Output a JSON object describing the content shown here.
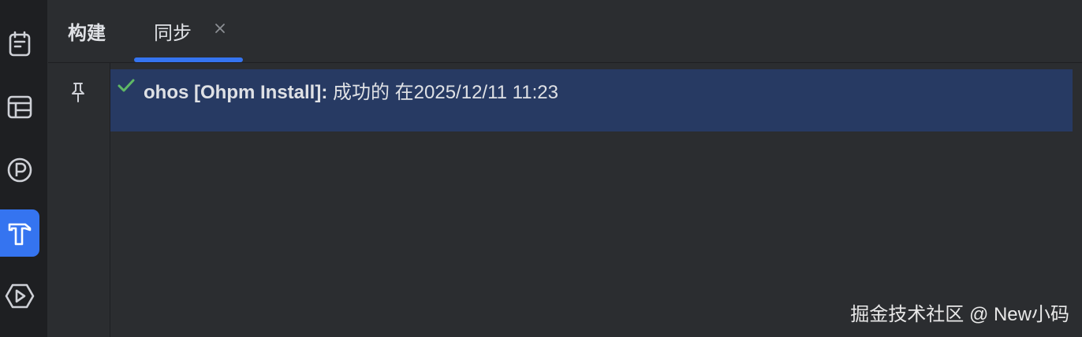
{
  "toolstrip": {
    "items": [
      {
        "icon": "notes-icon",
        "active": false
      },
      {
        "icon": "layout-icon",
        "active": false
      },
      {
        "icon": "p-circle-icon",
        "active": false
      },
      {
        "icon": "hammer-icon",
        "active": true
      },
      {
        "icon": "run-hexagon-icon",
        "active": false
      }
    ]
  },
  "tabs": [
    {
      "label": "构建",
      "active": false
    },
    {
      "label": "同步",
      "active": true,
      "closable": true
    }
  ],
  "result": {
    "status_icon": "check-icon",
    "task": "ohos [Ohpm Install]:",
    "message": "成功的 在2025/12/11 11:23"
  },
  "watermark": "掘金技术社区 @ New小码",
  "colors": {
    "accent": "#3574f0",
    "selection": "#273a63",
    "success": "#5fb865",
    "panel": "#2b2d30",
    "strip": "#1e1f22"
  }
}
